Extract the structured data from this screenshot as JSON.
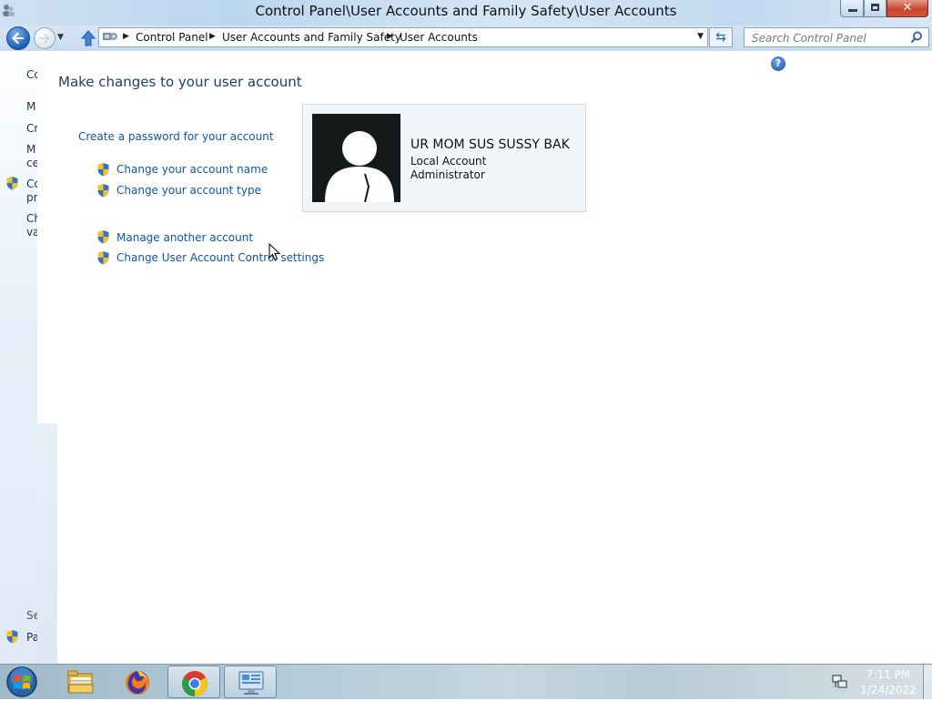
{
  "window": {
    "title": "Control Panel\\User Accounts and Family Safety\\User Accounts"
  },
  "nav": {
    "breadcrumbs": [
      "Control Panel",
      "User Accounts and Family Safety",
      "User Accounts"
    ],
    "search_placeholder": "Search Control Panel"
  },
  "leftpane": {
    "items": [
      "Co",
      "M",
      "Cr",
      "M",
      "ce",
      "Co",
      "pr",
      "Ch",
      "va"
    ],
    "see_also": "See als",
    "parental": "Parent"
  },
  "main": {
    "title": "Make changes to your user account",
    "tasks": {
      "create_password": "Create a password for your account",
      "change_name": "Change your account name",
      "change_type": "Change your account type",
      "manage_another": "Manage another account",
      "change_uac": "Change User Account Control settings"
    },
    "user": {
      "name": "UR MOM SUS SUSSY BAK",
      "type": "Local Account",
      "role": "Administrator"
    }
  },
  "taskbar": {
    "apps": [
      "start-button",
      "windows-explorer",
      "firefox",
      "google-chrome",
      "control-panel"
    ],
    "time": "7:11 PM",
    "date": "1/24/2022"
  },
  "colors": {
    "link": "#0d55aa",
    "title": "#1e3e6e"
  }
}
